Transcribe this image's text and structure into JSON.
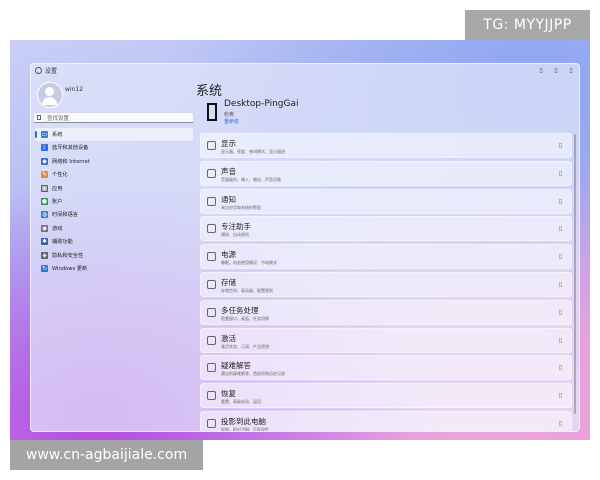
{
  "watermark": {
    "tg": "TG: MYYJJPP",
    "url": "www.cn-agbaijiale.com"
  },
  "window": {
    "title": "设置",
    "controls": [
      "minimize",
      "maximize",
      "close"
    ]
  },
  "user": {
    "name": "win12"
  },
  "search": {
    "placeholder": "查找设置"
  },
  "sidebar": {
    "items": [
      {
        "label": "系统",
        "icon": "system-icon",
        "color": "#3a7bd5",
        "active": true
      },
      {
        "label": "蓝牙和其他设备",
        "icon": "bluetooth-icon",
        "color": "#2d6ae0"
      },
      {
        "label": "网络和 Internet",
        "icon": "network-icon",
        "color": "#3a6fbf"
      },
      {
        "label": "个性化",
        "icon": "brush-icon",
        "color": "#e08a3a"
      },
      {
        "label": "应用",
        "icon": "apps-icon",
        "color": "#555a66"
      },
      {
        "label": "账户",
        "icon": "account-icon",
        "color": "#2f8f5a"
      },
      {
        "label": "时间和语言",
        "icon": "globe-icon",
        "color": "#2b7fc4"
      },
      {
        "label": "游戏",
        "icon": "game-icon",
        "color": "#6a6f7a"
      },
      {
        "label": "辅助功能",
        "icon": "accessibility-icon",
        "color": "#2d5fa8"
      },
      {
        "label": "隐私和安全性",
        "icon": "shield-icon",
        "color": "#5a6270"
      },
      {
        "label": "Windows 更新",
        "icon": "update-icon",
        "color": "#2b77cf"
      }
    ]
  },
  "main": {
    "title": "系统",
    "device": {
      "name": "Desktop-PingGai",
      "sub": "粉奥",
      "rename": "重命名"
    },
    "cards": [
      {
        "title": "显示",
        "desc": "显示器、亮度、夜间模式、显示描述",
        "icon": "display-icon"
      },
      {
        "title": "声音",
        "desc": "音量级别、输入、输出、声音设备",
        "icon": "sound-icon"
      },
      {
        "title": "通知",
        "desc": "来自应用和系统的警报",
        "icon": "notification-icon"
      },
      {
        "title": "专注助手",
        "desc": "通知、自动规则",
        "icon": "focus-icon"
      },
      {
        "title": "电源",
        "desc": "睡眠、电池使用情况、节电模式",
        "icon": "power-icon"
      },
      {
        "title": "存储",
        "desc": "存储空间、驱动器、配置规则",
        "icon": "storage-icon"
      },
      {
        "title": "多任务处理",
        "desc": "贴靠窗口、桌面、任务切换",
        "icon": "multitask-icon"
      },
      {
        "title": "激活",
        "desc": "激活状态、订阅、产品密钥",
        "icon": "activation-icon"
      },
      {
        "title": "疑难解答",
        "desc": "建议的疑难解答、首选项和历史记录",
        "icon": "troubleshoot-icon"
      },
      {
        "title": "恢复",
        "desc": "重置、高级启动、返回",
        "icon": "recovery-icon"
      },
      {
        "title": "投影到此电脑",
        "desc": "权限、配对 PIN、可发现性",
        "icon": "project-icon"
      }
    ]
  }
}
